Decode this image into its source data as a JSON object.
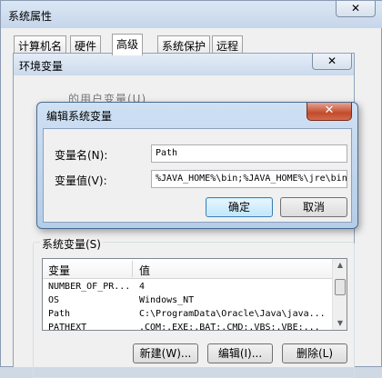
{
  "system_properties": {
    "title": "系统属性",
    "close_glyph": "✕",
    "tabs": [
      "计算机名",
      "硬件",
      "高级",
      "系统保护",
      "远程"
    ],
    "active_tab": "高级"
  },
  "env_window": {
    "title": "环境变量",
    "close_glyph": "✕",
    "behind_text": "的用户变量(U)",
    "system_vars_label": "系统变量(S)",
    "table": {
      "columns": [
        "变量",
        "值"
      ],
      "rows": [
        {
          "name": "NUMBER_OF_PR...",
          "value": "4"
        },
        {
          "name": "OS",
          "value": "Windows_NT"
        },
        {
          "name": "Path",
          "value": "C:\\ProgramData\\Oracle\\Java\\java..."
        },
        {
          "name": "PATHEXT",
          "value": ".COM;.EXE;.BAT;.CMD;.VBS;.VBE;..."
        }
      ]
    },
    "buttons": {
      "new": "新建(W)...",
      "edit": "编辑(I)...",
      "delete": "删除(L)"
    }
  },
  "edit_dialog": {
    "title": "编辑系统变量",
    "close_glyph": "✕",
    "name_label": "变量名(N):",
    "value_label": "变量值(V):",
    "name_value": "Path",
    "value_value": "%JAVA_HOME%\\bin;%JAVA_HOME%\\jre\\bin",
    "ok": "确定",
    "cancel": "取消"
  }
}
